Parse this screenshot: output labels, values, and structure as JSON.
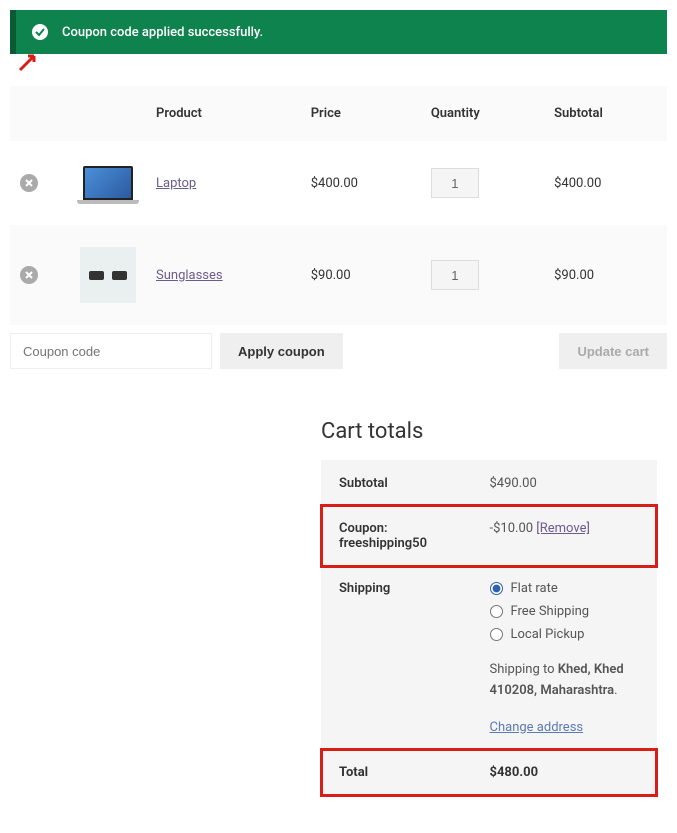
{
  "notice": {
    "text": "Coupon code applied successfully."
  },
  "table": {
    "headers": {
      "product": "Product",
      "price": "Price",
      "quantity": "Quantity",
      "subtotal": "Subtotal"
    },
    "rows": [
      {
        "name": "Laptop",
        "price": "$400.00",
        "qty": "1",
        "subtotal": "$400.00"
      },
      {
        "name": "Sunglasses",
        "price": "$90.00",
        "qty": "1",
        "subtotal": "$90.00"
      }
    ]
  },
  "actions": {
    "coupon_placeholder": "Coupon code",
    "apply_label": "Apply coupon",
    "update_label": "Update cart"
  },
  "totals": {
    "title": "Cart totals",
    "subtotal_label": "Subtotal",
    "subtotal_value": "$490.00",
    "coupon_label": "Coupon: freeshipping50",
    "coupon_value": "-$10.00 ",
    "remove_label": "[Remove]",
    "shipping_label": "Shipping",
    "shipping_options": {
      "flat": "Flat rate",
      "free": "Free Shipping",
      "pickup": "Local Pickup"
    },
    "shipping_to_prefix": "Shipping to ",
    "shipping_to_dest": "Khed, Khed 410208, Maharashtra",
    "change_addr": "Change address",
    "total_label": "Total",
    "total_value": "$480.00"
  }
}
